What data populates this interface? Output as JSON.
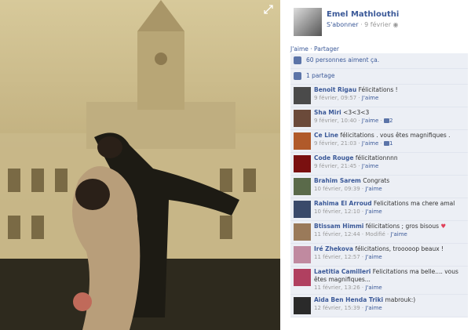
{
  "photo": {
    "expand_icon": "expand-arrows-icon"
  },
  "post": {
    "author": "Emel Mathlouthi",
    "subscribe": "S'abonner",
    "sep": "·",
    "date": "9 février",
    "globe_icon": "globe-icon",
    "like": "J'aime",
    "share": "Partager",
    "likes_text": "60 personnes aiment ça.",
    "shares_text": "1 partage"
  },
  "comments": [
    {
      "name": "Benoit Rigau",
      "text": "Félicitations !",
      "time": "9 février, 09:57",
      "like": "J'aime",
      "count": "",
      "avatar": "#4a4a4a"
    },
    {
      "name": "Sha Miri",
      "text": "<3<3<3",
      "time": "9 février, 10:40",
      "like": "J'aime",
      "count": "2",
      "avatar": "#6b4a3a"
    },
    {
      "name": "Ce Line",
      "text": "félicitations . vous êtes magnifiques .",
      "time": "9 février, 21:03",
      "like": "J'aime",
      "count": "1",
      "avatar": "#b05a2a"
    },
    {
      "name": "Code Rouge",
      "text": "félicitationnnn",
      "time": "9 février, 21:45",
      "like": "J'aime",
      "count": "",
      "avatar": "#7a1010"
    },
    {
      "name": "Brahim Sarem",
      "text": "Congrats",
      "time": "10 février, 09:39",
      "like": "J'aime",
      "count": "",
      "avatar": "#5a6a4a"
    },
    {
      "name": "Rahima El Arroud",
      "text": "Felicitations ma chere amal",
      "time": "10 février, 12:10",
      "like": "J'aime",
      "count": "",
      "avatar": "#3a4a6a"
    },
    {
      "name": "Btissam Himmi",
      "text": "félicitations ; gros bisous",
      "time": "11 février, 12:44",
      "modified": "Modifié",
      "like": "J'aime",
      "count": "",
      "heart": "♥",
      "avatar": "#9a7a5a"
    },
    {
      "name": "Iré Zhekova",
      "text": "félicitations, trooooop beaux !",
      "time": "11 février, 12:57",
      "like": "J'aime",
      "count": "",
      "avatar": "#c08aa0"
    },
    {
      "name": "Laetitia Camilleri",
      "text": "Felicitations ma belle.... vous êtes magnifiques...",
      "time": "11 février, 13:26",
      "like": "J'aime",
      "count": "",
      "avatar": "#b04060"
    },
    {
      "name": "Aida Ben Henda Triki",
      "text": "mabrouk:)",
      "time": "12 février, 15:39",
      "like": "J'aime",
      "count": "",
      "avatar": "#2a2a2a"
    }
  ]
}
